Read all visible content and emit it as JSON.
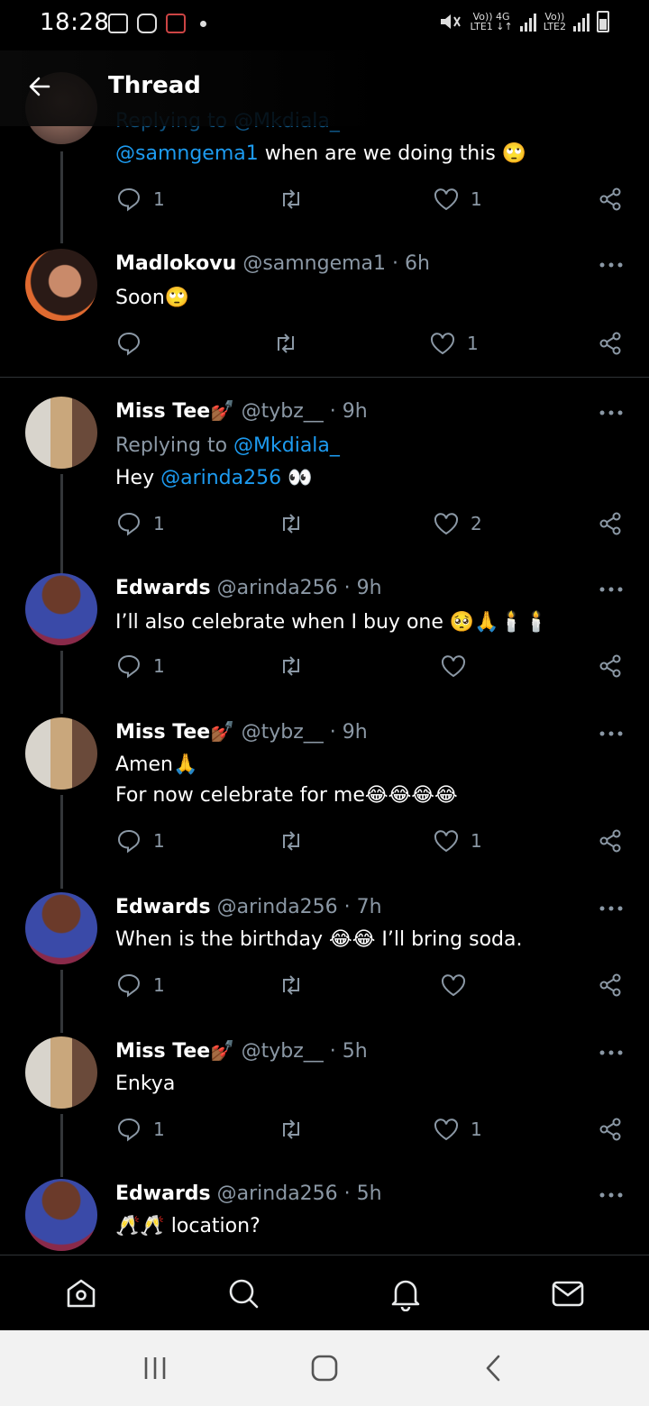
{
  "status_bar": {
    "time": "18:28",
    "net1": "Vo)) 4G",
    "net1_sub": "LTE1 ↓↑",
    "net2": "Vo))",
    "net2_sub": "LTE2"
  },
  "header": {
    "title": "Thread"
  },
  "tweets": [
    {
      "reply_to_partial": "Replying to @Mkdiala_",
      "text_mention": "@samngema1",
      "text_rest": " when are we doing this 🙄",
      "replies": "1",
      "retweets": "",
      "likes": "1"
    },
    {
      "name": "Madlokovu",
      "handle": "@samngema1",
      "time": "· 6h",
      "text": "Soon🙄",
      "replies": "",
      "retweets": "",
      "likes": "1"
    },
    {
      "name": "Miss Tee💅🏾",
      "handle": "@tybz__",
      "time": "· 9h",
      "reply_prefix": "Replying to ",
      "reply_handle": "@Mkdiala_",
      "text_prefix": "Hey ",
      "text_mention": "@arinda256",
      "text_rest": " 👀",
      "replies": "1",
      "retweets": "",
      "likes": "2"
    },
    {
      "name": "Edwards",
      "handle": "@arinda256",
      "time": "· 9h",
      "text": "I’ll also celebrate when I buy one 🥺🙏🕯️🕯️",
      "replies": "1",
      "retweets": "",
      "likes": ""
    },
    {
      "name": "Miss Tee💅🏾",
      "handle": "@tybz__",
      "time": "· 9h",
      "text_line1": "Amen🙏",
      "text_line2": "For now celebrate for me😂😂😂😂",
      "replies": "1",
      "retweets": "",
      "likes": "1"
    },
    {
      "name": "Edwards",
      "handle": "@arinda256",
      "time": "· 7h",
      "text": "When is the birthday 😂😂 I’ll bring soda.",
      "replies": "1",
      "retweets": "",
      "likes": ""
    },
    {
      "name": "Miss Tee💅🏾",
      "handle": "@tybz__",
      "time": "· 5h",
      "text": "Enkya",
      "replies": "1",
      "retweets": "",
      "likes": "1"
    },
    {
      "name": "Edwards",
      "handle": "@arinda256",
      "time": "· 5h",
      "text": "🥂🥂 location?"
    }
  ],
  "colors": {
    "accent": "#1d9bf0",
    "muted": "#8b98a5",
    "background": "#000000"
  },
  "icons": [
    "back-arrow-icon",
    "reply-icon",
    "retweet-icon",
    "like-icon",
    "share-icon",
    "more-icon",
    "home-icon",
    "search-icon",
    "notifications-icon",
    "messages-icon"
  ]
}
